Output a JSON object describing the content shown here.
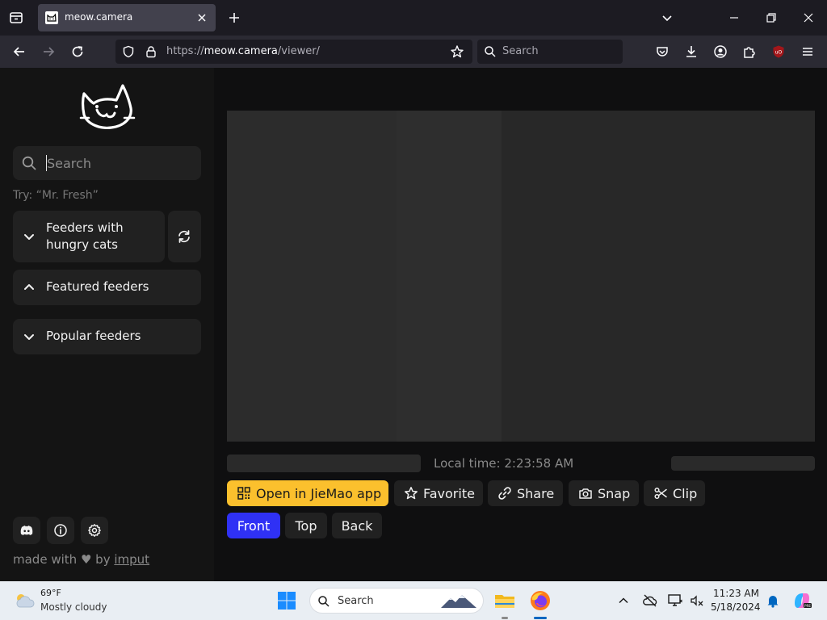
{
  "browser": {
    "tab": {
      "title": "meow.camera"
    },
    "url": {
      "scheme": "https://",
      "host": "meow.camera",
      "path": "/viewer/"
    },
    "search_placeholder": "Search"
  },
  "sidebar": {
    "search_placeholder": "Search",
    "search_hint": "Try: “Mr. Fresh”",
    "sections": [
      {
        "label": "Feeders with hungry cats",
        "expanded": false
      },
      {
        "label": "Featured feeders",
        "expanded": true
      },
      {
        "label": "Popular feeders",
        "expanded": false
      }
    ],
    "footer": {
      "made_with": "made with",
      "by": "by",
      "link": "imput"
    }
  },
  "player": {
    "local_time": "Local time: 2:23:58 AM",
    "actions": [
      {
        "label": "Open in JieMao app",
        "icon": "qr-icon"
      },
      {
        "label": "Favorite",
        "icon": "star-icon"
      },
      {
        "label": "Share",
        "icon": "link-icon"
      },
      {
        "label": "Snap",
        "icon": "camera-icon"
      },
      {
        "label": "Clip",
        "icon": "scissors-icon"
      }
    ],
    "views": [
      {
        "label": "Front",
        "active": true
      },
      {
        "label": "Top",
        "active": false
      },
      {
        "label": "Back",
        "active": false
      }
    ]
  },
  "taskbar": {
    "weather": {
      "temp": "69°F",
      "desc": "Mostly cloudy"
    },
    "search_label": "Search",
    "clock": {
      "time": "11:23 AM",
      "date": "5/18/2024"
    }
  },
  "colors": {
    "accent_yellow": "#fbc02d",
    "accent_blue": "#2f31f5",
    "panel": "#212121"
  }
}
